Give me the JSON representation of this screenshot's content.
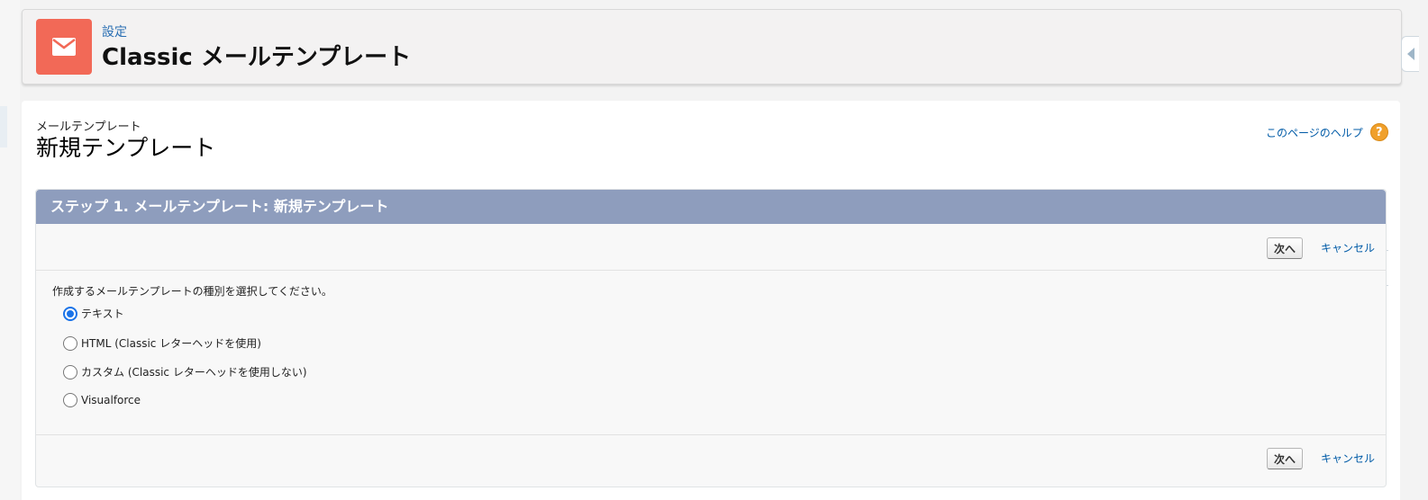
{
  "header": {
    "breadcrumb": "設定",
    "title": "Classic メールテンプレート",
    "icon": "envelope-icon",
    "icon_color": "#f26957"
  },
  "page": {
    "subtitle": "メールテンプレート",
    "title": "新規テンプレート",
    "help_link": "このページのヘルプ",
    "help_icon": "question-icon"
  },
  "step": {
    "header": "ステップ 1. メールテンプレート: 新規テンプレート",
    "header_color": "#8e9dbd",
    "next_label": "次へ",
    "cancel_label": "キャンセル",
    "prompt": "作成するメールテンプレートの種別を選択してください。",
    "options": [
      {
        "label": "テキスト",
        "checked": true
      },
      {
        "label": "HTML (Classic レターヘッドを使用)",
        "checked": false
      },
      {
        "label": "カスタム (Classic レターヘッドを使用しない)",
        "checked": false
      },
      {
        "label": "Visualforce",
        "checked": false
      }
    ]
  }
}
